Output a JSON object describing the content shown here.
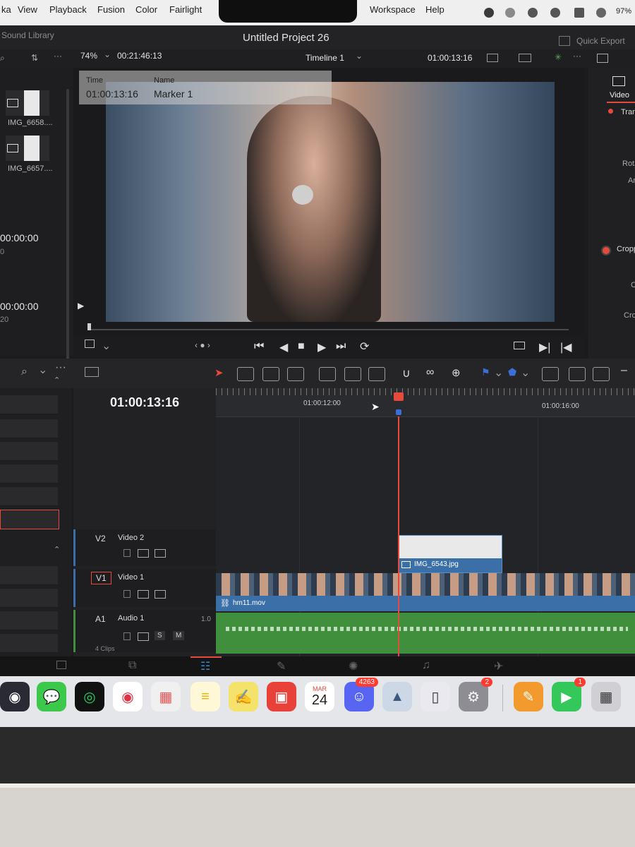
{
  "menubar": {
    "items": [
      "ka",
      "View",
      "Playback",
      "Fusion",
      "Color",
      "Fairlight",
      "Workspace",
      "Help"
    ],
    "battery": "97%"
  },
  "project": {
    "title": "Untitled Project 26",
    "quick_export": "Quick Export"
  },
  "media_pool": {
    "sound_library": "Sound Library",
    "clips": [
      "IMG_6658....",
      "IMG_6657...."
    ],
    "timecodes": [
      "00:00:00",
      "00:00:00"
    ],
    "sub_a": "0",
    "sub_b": "20"
  },
  "viewer": {
    "zoom": "74%",
    "duration": "00:21:46:13",
    "timeline_name": "Timeline 1",
    "timecode": "01:00:13:16",
    "marker": {
      "time_label": "Time",
      "time_value": "01:00:13:16",
      "name_label": "Name",
      "name_value": "Marker 1"
    }
  },
  "inspector": {
    "tab": "Video",
    "section1": "Tran",
    "rot": "Rota",
    "an": "An",
    "section2": "Cropp",
    "c": "C",
    "cro": "Cro"
  },
  "timeline": {
    "current_tc": "01:00:13:16",
    "ruler": [
      "01:00:12:00",
      "01:00:16:00"
    ],
    "tracks": [
      {
        "id": "V2",
        "name": "Video 2"
      },
      {
        "id": "V1",
        "name": "Video 1"
      },
      {
        "id": "A1",
        "name": "Audio 1",
        "level": "1.0"
      }
    ],
    "clip_v1": "hm11.mov",
    "clip_v2": "IMG_6543.jpg",
    "audio_solo": "S",
    "audio_mute": "M",
    "clips_label": "4 Clips"
  },
  "dock": {
    "calendar_month": "MAR",
    "calendar_day": "24",
    "discord_badge": "4263",
    "settings_badge": "2",
    "facetime_badge": "1"
  },
  "colors": {
    "accent_red": "#e64a3b",
    "clip_blue": "#3a6fa8",
    "audio_green": "#3f8f3c"
  }
}
